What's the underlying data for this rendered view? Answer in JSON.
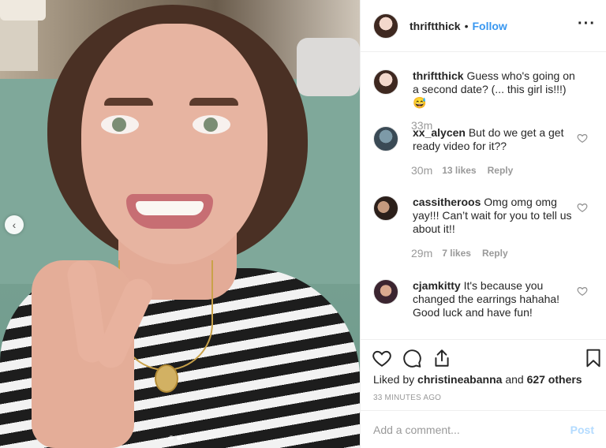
{
  "post": {
    "username": "thriftthick",
    "separator": "•",
    "follow_label": "Follow",
    "more_label": "···"
  },
  "photo": {
    "nav_prev_icon": "chevron-left-icon",
    "nav_prev_glyph": "‹"
  },
  "caption": {
    "username": "thriftthick",
    "text": "Guess who's going on a second date? (... this girl is!!!) 😅",
    "time": "33m"
  },
  "comments": [
    {
      "username": "xx_alycen",
      "text": "But do we get a get ready video for it??",
      "time": "30m",
      "likes": "13 likes",
      "reply": "Reply"
    },
    {
      "username": "cassitheroos",
      "text": "Omg omg omg yay!!! Can’t wait for you to tell us about it!!",
      "time": "29m",
      "likes": "7 likes",
      "reply": "Reply"
    },
    {
      "username": "cjamkitty",
      "text": "It's because you changed the earrings hahaha! Good luck and have fun!"
    }
  ],
  "actions": {
    "liked_by_prefix": "Liked by",
    "liked_by_user": "christineabanna",
    "liked_by_and": "and",
    "liked_by_others": "627 others",
    "timestamp": "33 MINUTES AGO"
  },
  "add_comment": {
    "placeholder": "Add a comment...",
    "post_label": "Post"
  },
  "colors": {
    "accent": "#3897f0",
    "post_disabled": "#b3dbff",
    "muted": "#999999"
  }
}
